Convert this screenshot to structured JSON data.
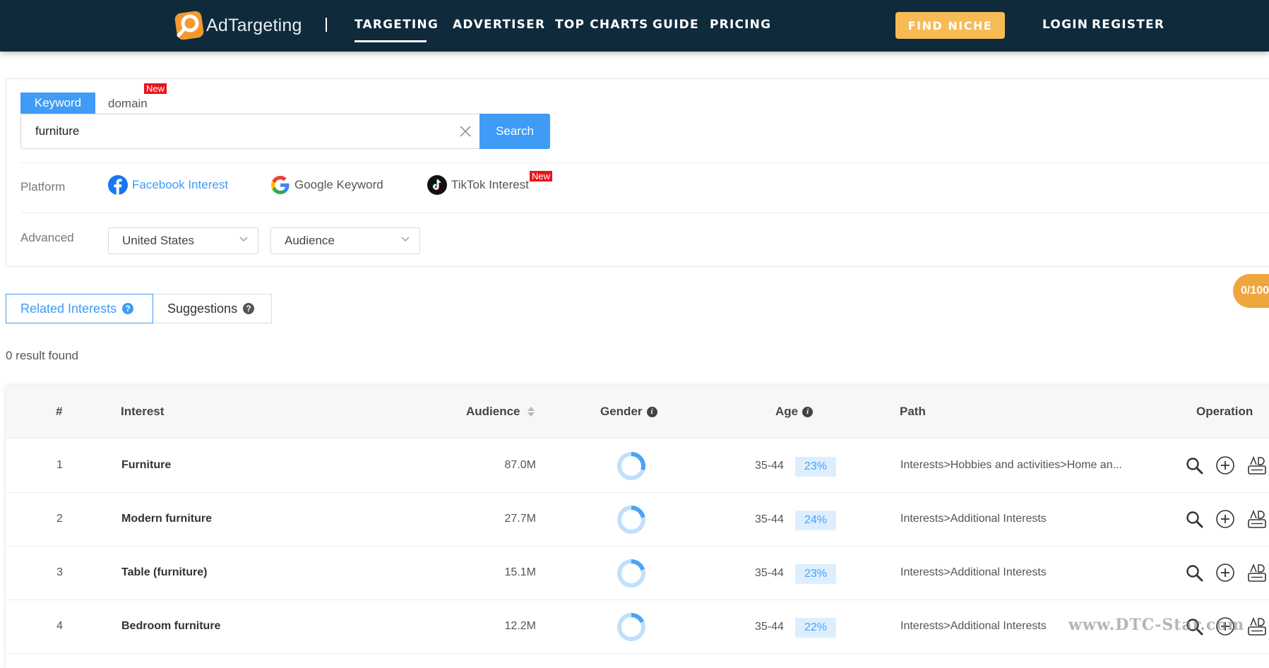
{
  "brand": {
    "name": "AdTargeting"
  },
  "nav": {
    "items": [
      "TARGETING",
      "ADVERTISER",
      "TOP CHARTS",
      "GUIDE",
      "PRICING"
    ],
    "find_niche": "FIND NICHE",
    "login": "LOGIN",
    "register": "REGISTER"
  },
  "search": {
    "tabs": {
      "keyword": "Keyword",
      "domain": "domain",
      "domain_badge": "New"
    },
    "value": "furniture",
    "button": "Search"
  },
  "platform": {
    "label": "Platform",
    "items": [
      {
        "label": "Facebook Interest",
        "icon": "facebook-icon",
        "selected": true
      },
      {
        "label": "Google Keyword",
        "icon": "google-icon",
        "selected": false
      },
      {
        "label": "TikTok Interest",
        "icon": "tiktok-icon",
        "selected": false,
        "badge": "New"
      }
    ]
  },
  "advanced": {
    "label": "Advanced",
    "country": "United States",
    "audience": "Audience"
  },
  "results": {
    "tabs": {
      "related": "Related Interests",
      "suggestions": "Suggestions"
    },
    "counter": "0/100",
    "count_text": "0 result found"
  },
  "table": {
    "headers": {
      "num": "#",
      "interest": "Interest",
      "audience": "Audience",
      "gender": "Gender",
      "age": "Age",
      "path": "Path",
      "operation": "Operation"
    },
    "rows": [
      {
        "num": "1",
        "interest": "Furniture",
        "audience": "87.0M",
        "female_share": 0.3,
        "age": "35-44",
        "age_pct": "23%",
        "path": "Interests>Hobbies and activities>Home an..."
      },
      {
        "num": "2",
        "interest": "Modern furniture",
        "audience": "27.7M",
        "female_share": 0.22,
        "age": "35-44",
        "age_pct": "24%",
        "path": "Interests>Additional Interests"
      },
      {
        "num": "3",
        "interest": "Table (furniture)",
        "audience": "15.1M",
        "female_share": 0.2,
        "age": "35-44",
        "age_pct": "23%",
        "path": "Interests>Additional Interests"
      },
      {
        "num": "4",
        "interest": "Bedroom furniture",
        "audience": "12.2M",
        "female_share": 0.18,
        "age": "35-44",
        "age_pct": "22%",
        "path": "Interests>Additional Interests"
      }
    ],
    "op_icons": [
      "search-icon",
      "add-circle-icon",
      "ad-icon"
    ]
  },
  "watermark": "www.DTC-Star.com",
  "colors": {
    "nav_bg": "#0f2a3b",
    "primary": "#3f9bf6",
    "accent": "#f7bb55",
    "badge": "#e8151b",
    "donut_light": "#bfe0fb",
    "donut_dark": "#4aa3f6"
  }
}
